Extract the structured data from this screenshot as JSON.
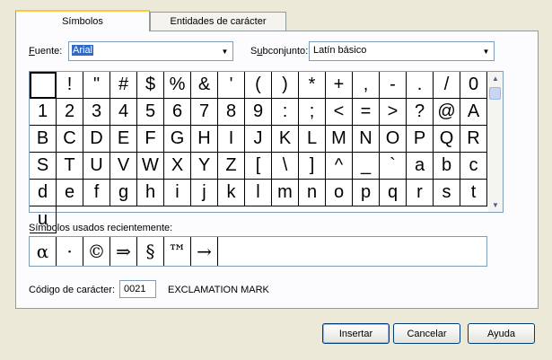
{
  "tabs": [
    {
      "label": "Símbolos",
      "active": true
    },
    {
      "label": "Entidades de carácter",
      "active": false
    }
  ],
  "font": {
    "label": "Fuente:",
    "value": "Arial"
  },
  "subset": {
    "label": "Subconjunto:",
    "value": "Latín básico"
  },
  "symbols": [
    " ",
    "!",
    "\"",
    "#",
    "$",
    "%",
    "&",
    "'",
    "(",
    ")",
    "*",
    "+",
    ",",
    "-",
    ".",
    "/",
    "0",
    "1",
    "2",
    "3",
    "4",
    "5",
    "6",
    "7",
    "8",
    "9",
    ":",
    ";",
    "<",
    "=",
    ">",
    "?",
    "@",
    "A",
    "B",
    "C",
    "D",
    "E",
    "F",
    "G",
    "H",
    "I",
    "J",
    "K",
    "L",
    "M",
    "N",
    "O",
    "P",
    "Q",
    "R",
    "S",
    "T",
    "U",
    "V",
    "W",
    "X",
    "Y",
    "Z",
    "[",
    "\\",
    "]",
    "^",
    "_",
    "`",
    "a",
    "b",
    "c",
    "d",
    "e",
    "f",
    "g",
    "h",
    "i",
    "j",
    "k",
    "l",
    "m",
    "n",
    "o",
    "p",
    "q",
    "r",
    "s",
    "t",
    "u"
  ],
  "selected_index": 0,
  "recent_label": "Símbolos usados recientemente:",
  "recent": [
    "α",
    "·",
    "©",
    "⇒",
    "§",
    "™",
    "→"
  ],
  "code_label": "Código de carácter:",
  "code_value": "0021",
  "char_name": "EXCLAMATION MARK",
  "buttons": {
    "insert": "Insertar",
    "cancel": "Cancelar",
    "help": "Ayuda"
  },
  "icons": {
    "dropdown": "chevron-down-icon",
    "scroll_up": "arrow-up-icon",
    "scroll_down": "arrow-down-icon"
  }
}
